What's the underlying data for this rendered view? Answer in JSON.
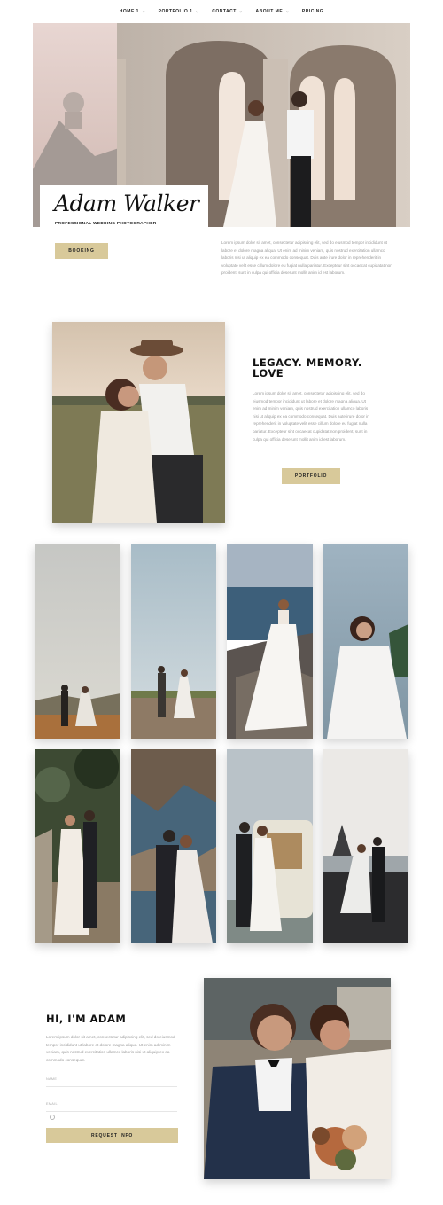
{
  "nav": {
    "items": [
      {
        "label": "HOME 1",
        "has_dropdown": true
      },
      {
        "label": "PORTFOLIO 1",
        "has_dropdown": true
      },
      {
        "label": "CONTACT",
        "has_dropdown": true
      },
      {
        "label": "ABOUT ME",
        "has_dropdown": true
      },
      {
        "label": "PRICING",
        "has_dropdown": false
      }
    ],
    "dropdown_icon": "chevron-down-icon"
  },
  "hero": {
    "name": "Adam Walker",
    "tagline": "PROFESSIONAL WEDDING PHOTOGRAPHER",
    "booking_label": "BOOKING",
    "text": "Lorem ipsum dolor sit amet, consectetur adipiscing elit, sed do eiusmod tempor incididunt ut labore et dolore magna aliqua. Ut enim ad minim veniam, quis nostrud exercitation ullamco laboris nisi ut aliquip ex ea commodo consequat. Duis aute irure dolor in reprehenderit in voluptate velit esse cillum dolore eu fugiat nulla pariatur. Excepteur sint occaecat cupidatat non proident, sunt in culpa qui officia deserunt mollit anim id est laborum."
  },
  "legacy": {
    "title": "LEGACY. MEMORY. LOVE",
    "text": "Lorem ipsum dolor sit amet, consectetur adipiscing elit, sed do eiusmod tempor incididunt ut labore et dolore magna aliqua. Ut enim ad minim veniam, quis nostrud exercitation ullamco laboris nisi ut aliquip ex ea commodo consequat. Duis aute irure dolor in reprehenderit in voluptate velit esse cillum dolore eu fugiat nulla pariatur. Excepteur sint occaecat cupidatat non proident, sunt in culpa qui officia deserunt mollit anim id est laborum.",
    "portfolio_label": "PORTFOLIO"
  },
  "about": {
    "title": "HI, I'M ADAM",
    "text": "Lorem ipsum dolor sit amet, consectetur adipiscing elit, sed do eiusmod tempor incididunt ut labore et dolore magna aliqua. Ut enim ad minim veniam, quis nostrud exercitation ullamco laboris nisi ut aliquip ex ea commodo consequat.",
    "name_label": "NAME",
    "email_label": "EMAIL",
    "date_icon": "calendar-icon",
    "request_label": "REQUEST INFO"
  },
  "colors": {
    "accent": "#d8c99a",
    "text_dark": "#111111",
    "text_muted": "#9a9a9a"
  }
}
